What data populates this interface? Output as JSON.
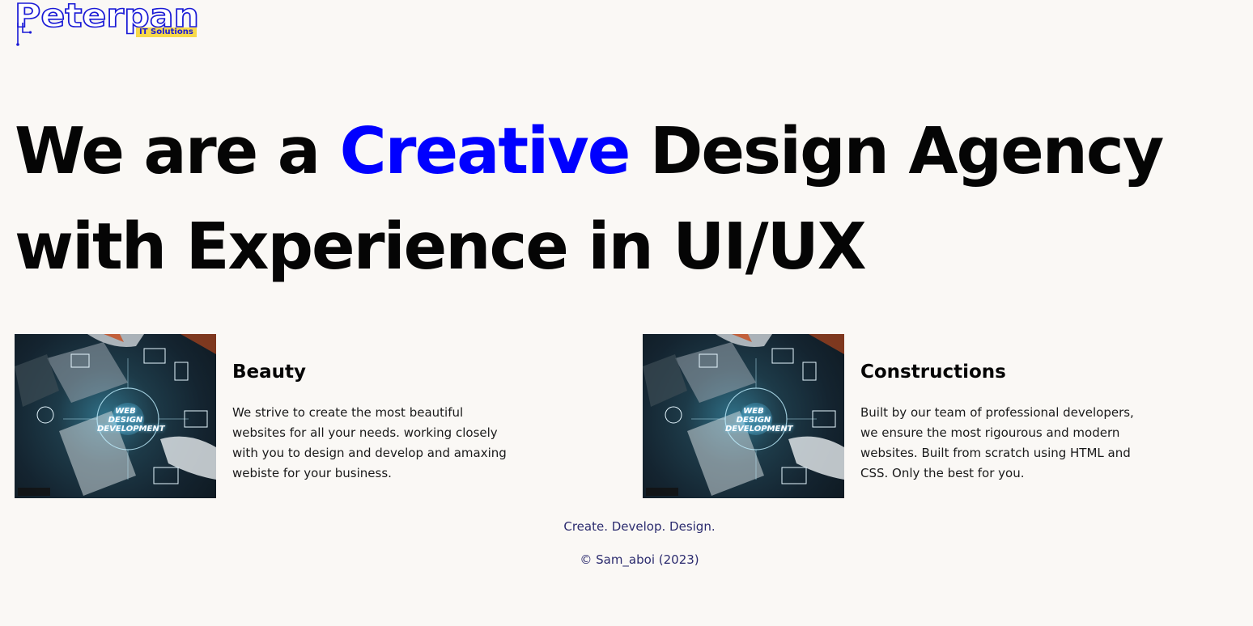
{
  "logo": {
    "wordmark": "Peterpan",
    "tagline": "IT Solutions",
    "colors": {
      "outline": "#1a1ad6",
      "tag_bg": "#f7d94a"
    }
  },
  "hero": {
    "part1": "We are a ",
    "accent": "Creative",
    "part2": " Design Agency with Experience in UI/UX",
    "accent_color": "#0000ff"
  },
  "cards": [
    {
      "image_icon": "web-design-development-photo",
      "image_caption": "WEB DESIGN DEVELOPMENT",
      "title": "Beauty",
      "text": "We strive to create the most beautiful websites for all your needs. working closely with you to design and develop and amaxing webiste for your business."
    },
    {
      "image_icon": "web-design-development-photo",
      "image_caption": "WEB DESIGN DEVELOPMENT",
      "title": "Constructions",
      "text": "Built by our team of professional developers, we ensure the most rigourous and modern websites. Built from scratch using HTML and CSS. Only the best for you."
    }
  ],
  "footer": {
    "tagline": "Create. Develop. Design.",
    "copyright": "© Sam_aboi (2023)",
    "color": "#2b2b6e"
  },
  "page": {
    "background": "#faf8f5"
  }
}
